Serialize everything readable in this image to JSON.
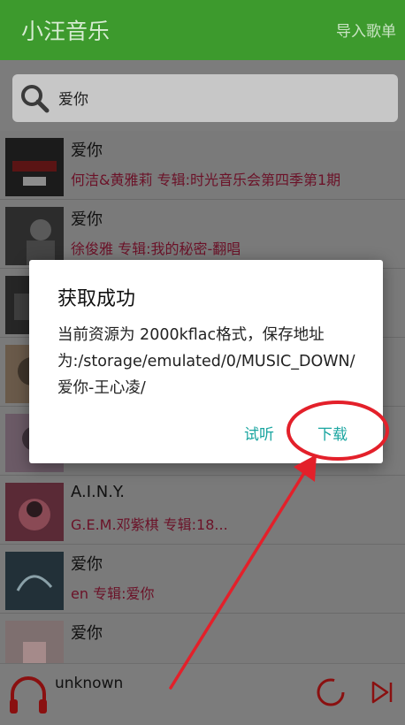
{
  "appbar": {
    "title": "小汪音乐",
    "import_label": "导入歌单"
  },
  "search": {
    "query": "爱你"
  },
  "songs": [
    {
      "title": "爱你",
      "meta": "何洁&黄雅莉   专辑:时光音乐会第四季第1期"
    },
    {
      "title": "爱你",
      "meta": "徐俊雅   专辑:我的秘密-翻唱"
    },
    {
      "title": "",
      "meta": ""
    },
    {
      "title": "",
      "meta": ""
    },
    {
      "title": "",
      "meta": ""
    },
    {
      "title": "A.I.N.Y.",
      "meta": "G.E.M.邓紫棋   专辑:18..."
    },
    {
      "title": "爱你",
      "meta": "en   专辑:爱你"
    },
    {
      "title": "爱你",
      "meta": ""
    }
  ],
  "player": {
    "track": "unknown"
  },
  "dialog": {
    "title": "获取成功",
    "message": "当前资源为 2000kflac格式，保存地址为:/storage/emulated/0/MUSIC_DOWN/爱你-王心凌/",
    "listen_label": "试听",
    "download_label": "下载"
  },
  "colors": {
    "appbar": "#3d9a2d",
    "accent": "#1aa5a0",
    "annotation": "#e3202a"
  }
}
